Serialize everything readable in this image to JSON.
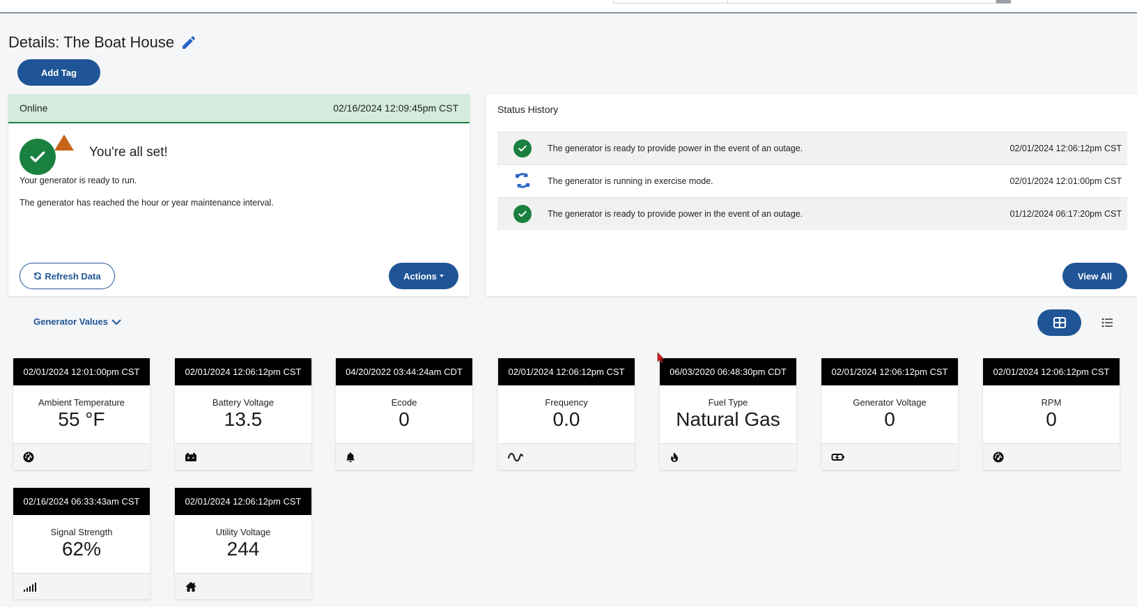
{
  "page": {
    "title": "Details: The Boat House",
    "add_tag_label": "Add Tag"
  },
  "status": {
    "state": "Online",
    "timestamp": "02/16/2024 12:09:45pm CST",
    "headline": "You're all set!",
    "messages": [
      "Your generator is ready to run.",
      "The generator has reached the hour or year maintenance interval."
    ],
    "refresh_label": "Refresh Data",
    "actions_label": "Actions",
    "colors": {
      "ok": "#1a8040",
      "warning": "#c6651a",
      "header_bg": "#d3ecdd"
    }
  },
  "history": {
    "title": "Status History",
    "rows": [
      {
        "icon": "check-circle-icon",
        "text": "The generator is ready to provide power in the event of an outage.",
        "date": "02/01/2024 12:06:12pm CST"
      },
      {
        "icon": "exercise-cycle-icon",
        "text": "The generator is running in exercise mode.",
        "date": "02/01/2024 12:01:00pm CST"
      },
      {
        "icon": "check-circle-icon",
        "text": "The generator is ready to provide power in the event of an outage.",
        "date": "01/12/2024 06:17:20pm CST"
      }
    ],
    "view_all_label": "View All"
  },
  "values": {
    "section_label": "Generator Values",
    "tiles": [
      {
        "date": "02/01/2024 12:01:00pm CST",
        "label": "Ambient Temperature",
        "value": "55 °F",
        "icon": "gauge-icon"
      },
      {
        "date": "02/01/2024 12:06:12pm CST",
        "label": "Battery Voltage",
        "value": "13.5",
        "icon": "battery-icon"
      },
      {
        "date": "04/20/2022 03:44:24am CDT",
        "label": "Ecode",
        "value": "0",
        "icon": "bell-icon"
      },
      {
        "date": "02/01/2024 12:06:12pm CST",
        "label": "Frequency",
        "value": "0.0",
        "icon": "sine-wave-icon"
      },
      {
        "date": "06/03/2020 06:48:30pm CDT",
        "label": "Fuel Type",
        "value": "Natural Gas",
        "icon": "flame-icon"
      },
      {
        "date": "02/01/2024 12:06:12pm CST",
        "label": "Generator Voltage",
        "value": "0",
        "icon": "plug-icon"
      },
      {
        "date": "02/01/2024 12:06:12pm CST",
        "label": "RPM",
        "value": "0",
        "icon": "gauge-icon"
      },
      {
        "date": "02/16/2024 06:33:43am CST",
        "label": "Signal Strength",
        "value": "62%",
        "icon": "signal-icon"
      },
      {
        "date": "02/01/2024 12:06:12pm CST",
        "label": "Utility Voltage",
        "value": "244",
        "icon": "home-icon"
      }
    ]
  },
  "theme": {
    "primary": "#1f5596",
    "tile_header": "#000000"
  }
}
